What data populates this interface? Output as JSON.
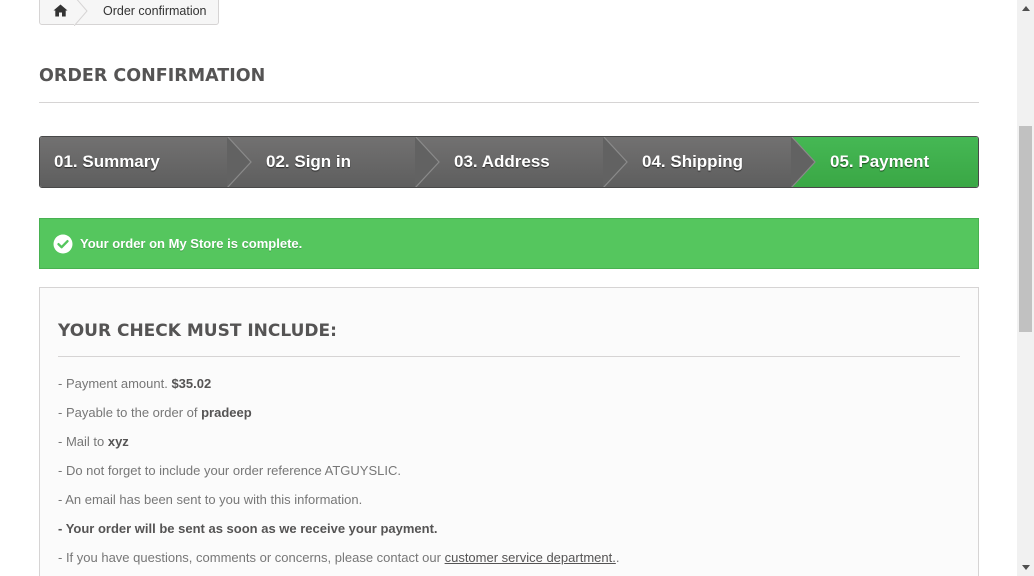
{
  "breadcrumb": {
    "home_icon": "home-icon",
    "current": "Order confirmation"
  },
  "page_heading": "ORDER CONFIRMATION",
  "steps": [
    {
      "label": "01. Summary",
      "active": false
    },
    {
      "label": "02. Sign in",
      "active": false
    },
    {
      "label": "03. Address",
      "active": false
    },
    {
      "label": "04. Shipping",
      "active": false
    },
    {
      "label": "05. Payment",
      "active": true
    }
  ],
  "alert": {
    "icon": "check-circle-icon",
    "text_before": "Your order on ",
    "store_name": "My Store",
    "text_after": " is complete."
  },
  "check_box": {
    "title": "YOUR CHECK MUST INCLUDE:",
    "payment_amount_label": "- Payment amount. ",
    "payment_amount_value": "$35.02",
    "payable_label": "- Payable to the order of ",
    "payable_value": "pradeep",
    "mail_label": "- Mail to ",
    "mail_value": "xyz",
    "reference_text": "- Do not forget to include your order reference ATGUYSLIC.",
    "email_text": "- An email has been sent to you with this information.",
    "sent_text": "- Your order will be sent as soon as we receive your payment.",
    "questions_text": "- If you have questions, comments or concerns, please contact our ",
    "questions_link": "customer service department.",
    "questions_end": "."
  },
  "colors": {
    "step_inactive": "#666666",
    "step_active": "#3fb04b",
    "alert_bg": "#55c65e"
  }
}
